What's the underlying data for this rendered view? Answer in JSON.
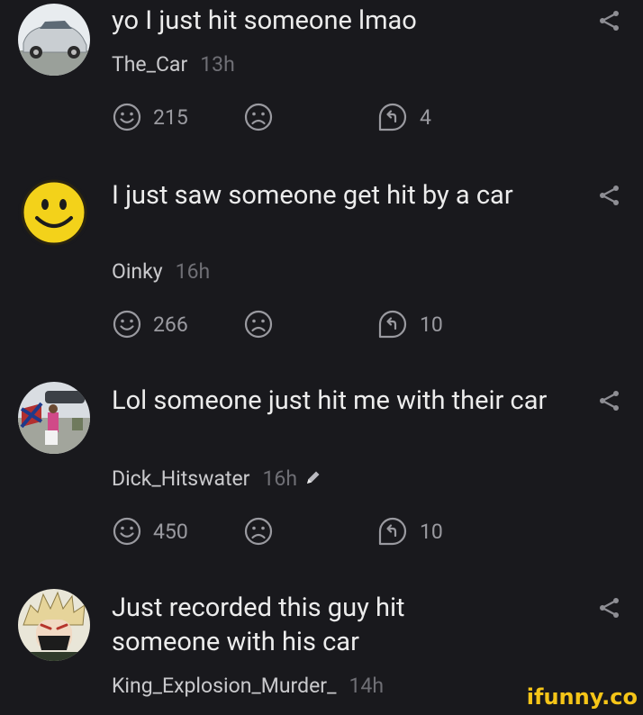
{
  "comments": [
    {
      "text": "yo I just hit someone lmao",
      "username": "The_Car",
      "time": "13h",
      "likes": "215",
      "replies": "4"
    },
    {
      "text": "I just saw someone get hit by a car",
      "username": "Oinky",
      "time": "16h",
      "likes": "266",
      "replies": "10"
    },
    {
      "text": "Lol someone just hit me with their car",
      "username": "Dick_Hitswater",
      "time": "16h",
      "likes": "450",
      "replies": "10"
    },
    {
      "text": "Just recorded this guy hit someone with his car",
      "username": "King_Explosion_Murder_",
      "time": "14h"
    }
  ],
  "watermark": "ifunny.co",
  "colors": {
    "background": "#19191d",
    "text": "#ececec",
    "muted": "#6f6f75",
    "icon": "#9a9aa0",
    "watermark": "#f5c518"
  }
}
